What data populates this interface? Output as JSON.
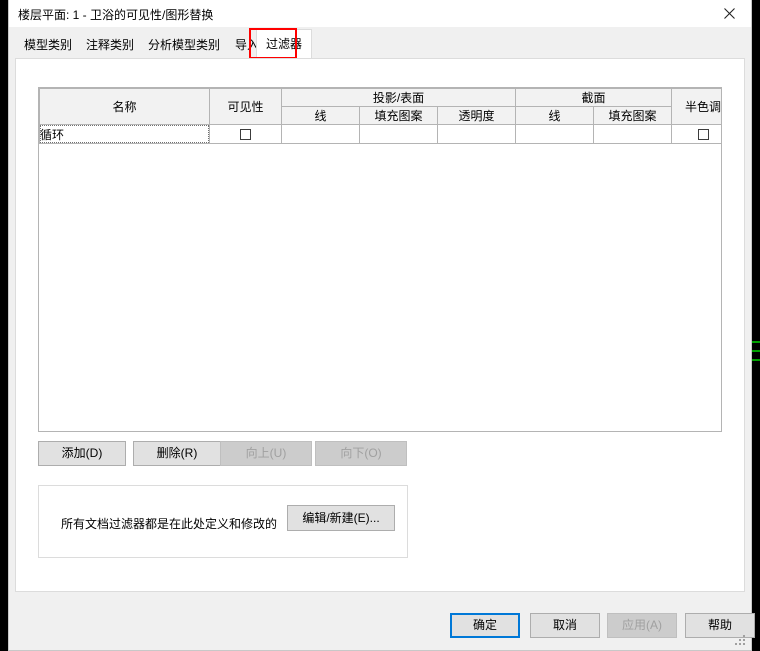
{
  "window": {
    "title": "楼层平面: 1 - 卫浴的可见性/图形替换",
    "close_icon": "close-icon"
  },
  "tabs": [
    {
      "label": "模型类别",
      "selected": false
    },
    {
      "label": "注释类别",
      "selected": false
    },
    {
      "label": "分析模型类别",
      "selected": false
    },
    {
      "label": "导入的类别",
      "selected": false
    },
    {
      "label": "过滤器",
      "selected": true
    }
  ],
  "highlight_color": "#ff0000",
  "grid": {
    "headers": {
      "name": "名称",
      "visibility": "可见性",
      "projection_surface": "投影/表面",
      "section": "截面",
      "halftone": "半色调",
      "proj_line": "线",
      "proj_pattern": "填充图案",
      "proj_transparency": "透明度",
      "sec_line": "线",
      "sec_pattern": "填充图案"
    },
    "rows": [
      {
        "name": "循环",
        "visibility_checked": false,
        "proj_line": "",
        "proj_pattern": "",
        "proj_transparency": "",
        "sec_line": "",
        "sec_pattern": "",
        "sec_disabled": true,
        "halftone_checked": false,
        "selected": true
      }
    ]
  },
  "list_buttons": {
    "add": "添加(D)",
    "add_accel": "D",
    "delete": "删除(R)",
    "delete_accel": "R",
    "move_up": "向上(U)",
    "move_up_accel": "U",
    "move_down": "向下(O)",
    "move_down_accel": "O"
  },
  "group": {
    "description": "所有文档过滤器都是在此处定义和修改的",
    "edit_new": "编辑/新建(E)...",
    "edit_new_accel": "E"
  },
  "footer": {
    "ok": "确定",
    "cancel": "取消",
    "apply": "应用(A)",
    "apply_accel": "A",
    "help": "帮助"
  }
}
